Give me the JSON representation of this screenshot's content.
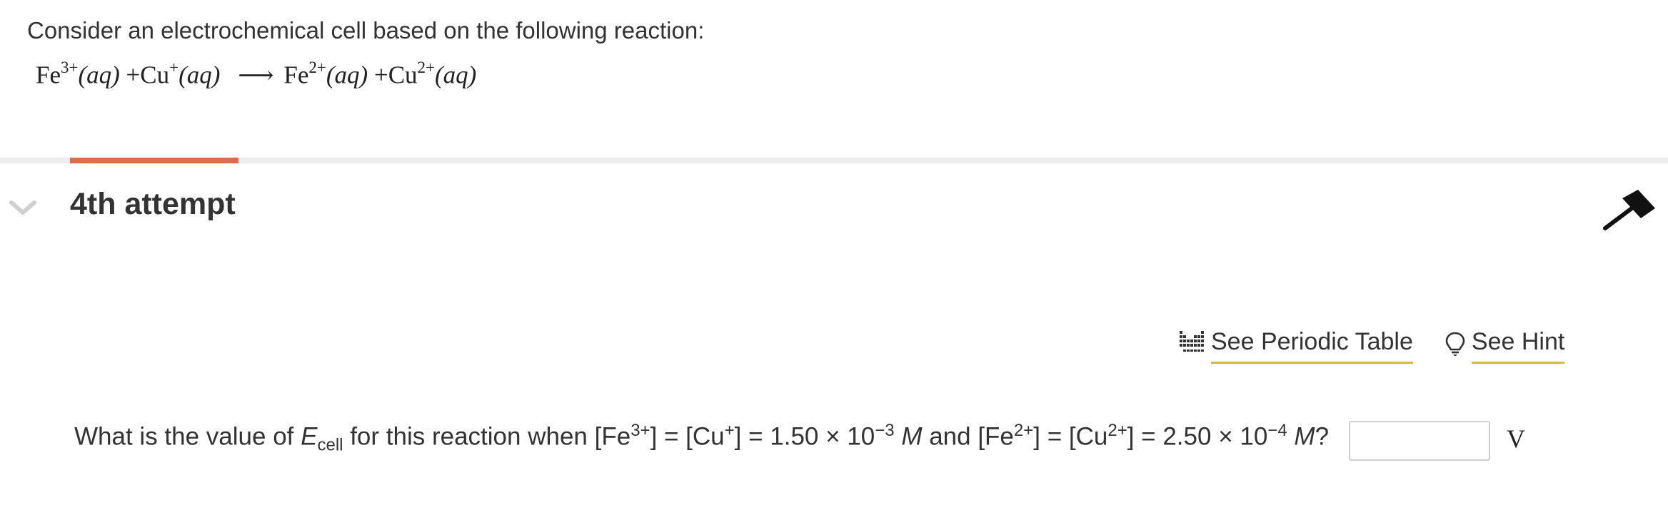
{
  "problem": {
    "intro": "Consider an electrochemical cell based on the following reaction:",
    "equation": {
      "r1": "Fe",
      "r1_charge": "3+",
      "r1_state": "(aq)",
      "plus1": "+",
      "r2": "Cu",
      "r2_charge": "+",
      "r2_state": "(aq)",
      "arrow": "⟶",
      "p1": "Fe",
      "p1_charge": "2+",
      "p1_state": "(aq)",
      "plus2": "+",
      "p2": "Cu",
      "p2_charge": "2+",
      "p2_state": "(aq)"
    }
  },
  "attempt": {
    "title": "4th attempt",
    "progress_color": "#e06b4c"
  },
  "tools": {
    "periodic_label": "See Periodic Table",
    "periodic_icon": "periodic-table-icon",
    "hint_label": "See Hint",
    "hint_icon": "lightbulb-icon"
  },
  "question": {
    "t1": "What is the value of ",
    "E": "E",
    "cell": "cell",
    "t2": " for this reaction when [Fe",
    "fe3": "3+",
    "t3": "] = [Cu",
    "cu1": "+",
    "t4": "] = 1.50 × 10",
    "exp1": "−3",
    "M1": "M",
    "t5": " and [Fe",
    "fe2": "2+",
    "t6": "] = [Cu",
    "cu2": "2+",
    "t7": "] = 2.50 × 10",
    "exp2": "−4",
    "M2": "M",
    "t8": "?"
  },
  "answer": {
    "value": "",
    "unit": "V"
  }
}
